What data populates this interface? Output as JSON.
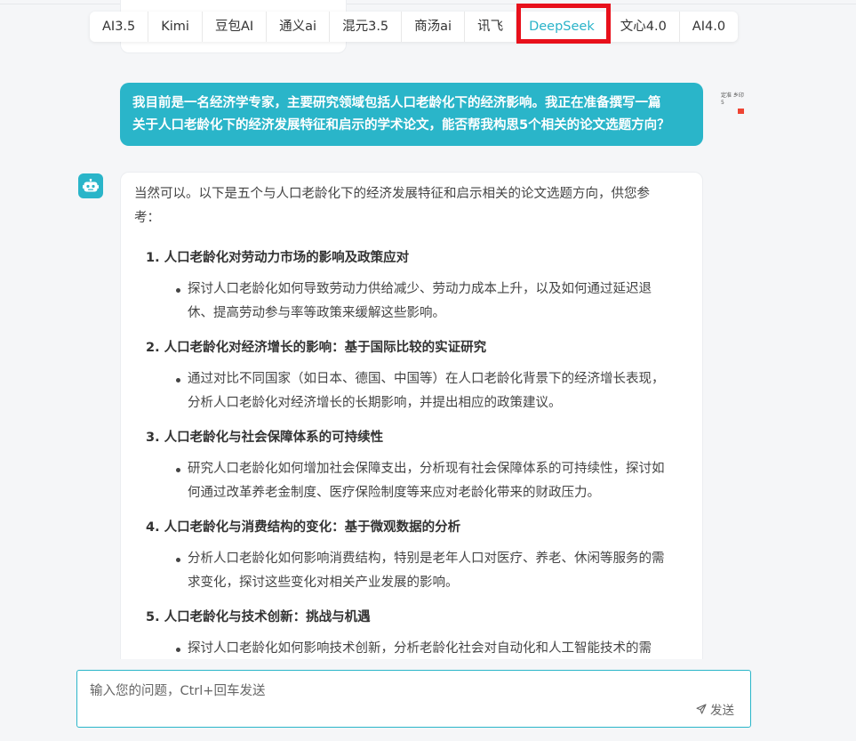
{
  "tabs": [
    "AI3.5",
    "Kimi",
    "豆包AI",
    "通义ai",
    "混元3.5",
    "商汤ai",
    "讯飞",
    "DeepSeek",
    "文心4.0",
    "AI4.0"
  ],
  "active_tab": "DeepSeek",
  "user_message": {
    "line1": "我目前是一名经济学专家，主要研究领域包括人口老龄化下的经济影响。我正在准备撰写一篇",
    "line2": "关于人口老龄化下的经济发展特征和启示的学术论文，能否帮我构思5个相关的论文选题方向？",
    "avatar_text": "定准 乡印 5"
  },
  "bot_message": {
    "intro_line1": "当然可以。以下是五个与人口老龄化下的经济发展特征和启示相关的论文选题方向，供您参",
    "intro_line2": "考：",
    "items": [
      {
        "title": "1. 人口老龄化对劳动力市场的影响及政策应对",
        "desc_line1": "探讨人口老龄化如何导致劳动力供给减少、劳动力成本上升，以及如何通过延迟退",
        "desc_line2": "休、提高劳动参与率等政策来缓解这些影响。"
      },
      {
        "title": "2. 人口老龄化对经济增长的影响：基于国际比较的实证研究",
        "desc_line1": "通过对比不同国家（如日本、德国、中国等）在人口老龄化背景下的经济增长表现，",
        "desc_line2": "分析人口老龄化对经济增长的长期影响，并提出相应的政策建议。"
      },
      {
        "title": "3. 人口老龄化与社会保障体系的可持续性",
        "desc_line1": "研究人口老龄化如何增加社会保障支出，分析现有社会保障体系的可持续性，探讨如",
        "desc_line2": "何通过改革养老金制度、医疗保险制度等来应对老龄化带来的财政压力。"
      },
      {
        "title": "4. 人口老龄化与消费结构的变化：基于微观数据的分析",
        "desc_line1": "分析人口老龄化如何影响消费结构，特别是老年人口对医疗、养老、休闲等服务的需",
        "desc_line2": "求变化，探讨这些变化对相关产业发展的影响。"
      },
      {
        "title": "5. 人口老龄化与技术创新：挑战与机遇",
        "desc_line1": "探讨人口老龄化如何影响技术创新，分析老龄化社会对自动化和人工智能技术的需",
        "desc_line2": ""
      }
    ]
  },
  "input": {
    "placeholder": "输入您的问题，Ctrl+回车发送",
    "value": "",
    "send_label": "发送"
  },
  "colors": {
    "accent": "#2ab5c9",
    "highlight": "#e8101b"
  }
}
